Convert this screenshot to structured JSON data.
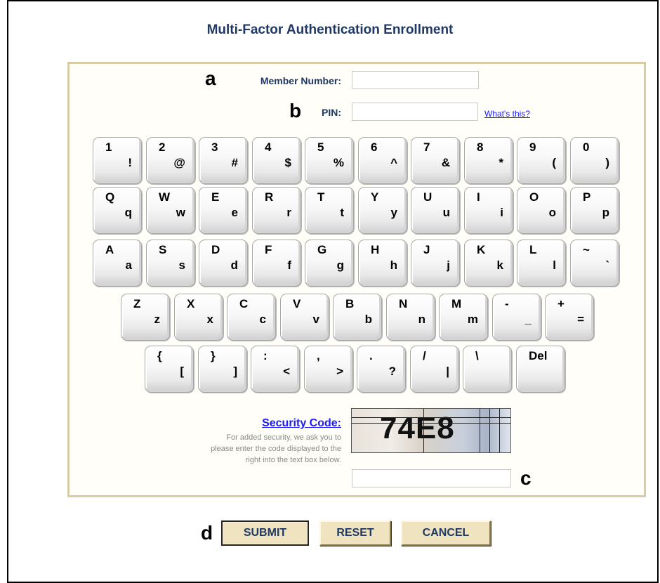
{
  "title": "Multi-Factor Authentication Enrollment",
  "markers": {
    "a": "a",
    "b": "b",
    "c": "c",
    "d": "d"
  },
  "form": {
    "member_label": "Member Number:",
    "member_value": "",
    "pin_label": "PIN:",
    "pin_value": "",
    "whats_this": "What's this?"
  },
  "keyboard": {
    "rows": [
      [
        {
          "top": "1",
          "bottom": "!"
        },
        {
          "top": "2",
          "bottom": "@"
        },
        {
          "top": "3",
          "bottom": "#"
        },
        {
          "top": "4",
          "bottom": "$"
        },
        {
          "top": "5",
          "bottom": "%"
        },
        {
          "top": "6",
          "bottom": "^"
        },
        {
          "top": "7",
          "bottom": "&"
        },
        {
          "top": "8",
          "bottom": "*"
        },
        {
          "top": "9",
          "bottom": "("
        },
        {
          "top": "0",
          "bottom": ")"
        }
      ],
      [
        {
          "top": "Q",
          "bottom": "q"
        },
        {
          "top": "W",
          "bottom": "w"
        },
        {
          "top": "E",
          "bottom": "e"
        },
        {
          "top": "R",
          "bottom": "r"
        },
        {
          "top": "T",
          "bottom": "t"
        },
        {
          "top": "Y",
          "bottom": "y"
        },
        {
          "top": "U",
          "bottom": "u"
        },
        {
          "top": "I",
          "bottom": "i"
        },
        {
          "top": "O",
          "bottom": "o"
        },
        {
          "top": "P",
          "bottom": "p"
        }
      ],
      [
        {
          "top": "A",
          "bottom": "a"
        },
        {
          "top": "S",
          "bottom": "s"
        },
        {
          "top": "D",
          "bottom": "d"
        },
        {
          "top": "F",
          "bottom": "f"
        },
        {
          "top": "G",
          "bottom": "g"
        },
        {
          "top": "H",
          "bottom": "h"
        },
        {
          "top": "J",
          "bottom": "j"
        },
        {
          "top": "K",
          "bottom": "k"
        },
        {
          "top": "L",
          "bottom": "l"
        },
        {
          "top": "~",
          "bottom": "`"
        }
      ],
      [
        {
          "top": "Z",
          "bottom": "z"
        },
        {
          "top": "X",
          "bottom": "x"
        },
        {
          "top": "C",
          "bottom": "c"
        },
        {
          "top": "V",
          "bottom": "v"
        },
        {
          "top": "B",
          "bottom": "b"
        },
        {
          "top": "N",
          "bottom": "n"
        },
        {
          "top": "M",
          "bottom": "m"
        },
        {
          "top": "-",
          "bottom": "_"
        },
        {
          "top": "+",
          "bottom": "="
        }
      ],
      [
        {
          "top": "{",
          "bottom": "["
        },
        {
          "top": "}",
          "bottom": "]"
        },
        {
          "top": ":",
          "bottom": "<"
        },
        {
          "top": ",",
          "bottom": ">"
        },
        {
          "top": ".",
          "bottom": "?"
        },
        {
          "top": "/",
          "bottom": "|"
        },
        {
          "top": "\\",
          "bottom": ""
        },
        {
          "top": "Del",
          "bottom": ""
        }
      ]
    ]
  },
  "security": {
    "heading": "Security Code:",
    "description": "For added security, we ask you to please enter the code displayed to the right into the text box below.",
    "captcha_text": "74E8",
    "input_value": ""
  },
  "buttons": {
    "submit": "SUBMIT",
    "reset": "RESET",
    "cancel": "CANCEL"
  },
  "colors": {
    "heading": "#1f3864",
    "link": "#1a1aff",
    "panel_border": "#d8cca6",
    "button_bg": "#efe4bf"
  }
}
